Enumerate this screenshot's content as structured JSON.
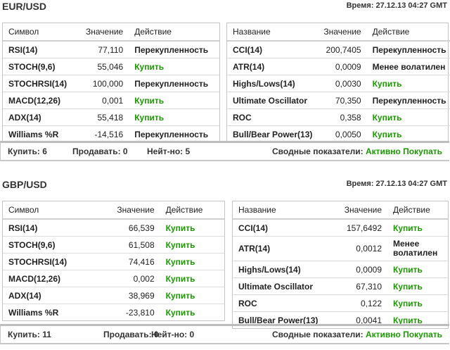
{
  "colors": {
    "buy": "#1a9a00"
  },
  "sections": [
    {
      "pair": "EUR/USD",
      "time": "Время: 27.12.13 04:27 GMT",
      "left_headers": [
        "Символ",
        "Значение",
        "Действие"
      ],
      "left": [
        [
          "RSI(14)",
          "77,110",
          "Перекупленность"
        ],
        [
          "STOCH(9,6)",
          "55,046",
          "Купить"
        ],
        [
          "STOCHRSI(14)",
          "100,000",
          "Перекупленность"
        ],
        [
          "MACD(12,26)",
          "0,001",
          "Купить"
        ],
        [
          "ADX(14)",
          "55,418",
          "Купить"
        ],
        [
          "Williams %R",
          "-14,516",
          "Перекупленность"
        ]
      ],
      "right_headers": [
        "Название",
        "Значение",
        "Действие"
      ],
      "right": [
        [
          "CCI(14)",
          "200,7405",
          "Перекупленность"
        ],
        [
          "ATR(14)",
          "0,0009",
          "Менее волатилен"
        ],
        [
          "Highs/Lows(14)",
          "0,0030",
          "Купить"
        ],
        [
          "Ultimate Oscillator",
          "70,350",
          "Перекупленность"
        ],
        [
          "ROC",
          "0,358",
          "Купить"
        ],
        [
          "Bull/Bear Power(13)",
          "0,0050",
          "Купить"
        ]
      ],
      "buy": "Купить: 6",
      "sell": "Продавать: 0",
      "neutral": "Нейт-но: 5",
      "summary_label": "Сводные показатели:",
      "summary_value": "Активно Покупать"
    },
    {
      "pair": "GBP/USD",
      "time": "Время: 27.12.13 04:27 GMT",
      "left_headers": [
        "Символ",
        "Значение",
        "Действие"
      ],
      "left": [
        [
          "RSI(14)",
          "66,539",
          "Купить"
        ],
        [
          "STOCH(9,6)",
          "61,508",
          "Купить"
        ],
        [
          "STOCHRSI(14)",
          "74,416",
          "Купить"
        ],
        [
          "MACD(12,26)",
          "0,002",
          "Купить"
        ],
        [
          "ADX(14)",
          "38,969",
          "Купить"
        ],
        [
          "Williams %R",
          "-23,810",
          "Купить"
        ]
      ],
      "right_headers": [
        "Название",
        "Значение",
        "Действие"
      ],
      "right": [
        [
          "CCI(14)",
          "157,6492",
          "Купить"
        ],
        [
          "ATR(14)",
          "0,0012",
          "Менее волатилен"
        ],
        [
          "Highs/Lows(14)",
          "0,0009",
          "Купить"
        ],
        [
          "Ultimate Oscillator",
          "67,310",
          "Купить"
        ],
        [
          "ROC",
          "0,122",
          "Купить"
        ],
        [
          "Bull/Bear Power(13)",
          "0,0041",
          "Купить"
        ]
      ],
      "buy": "Купить: 11",
      "sell": "Продавать: 0",
      "neutral": "Нейт-но: 0",
      "summary_label": "Сводные показатели:",
      "summary_value": "Активно Покупать"
    }
  ]
}
